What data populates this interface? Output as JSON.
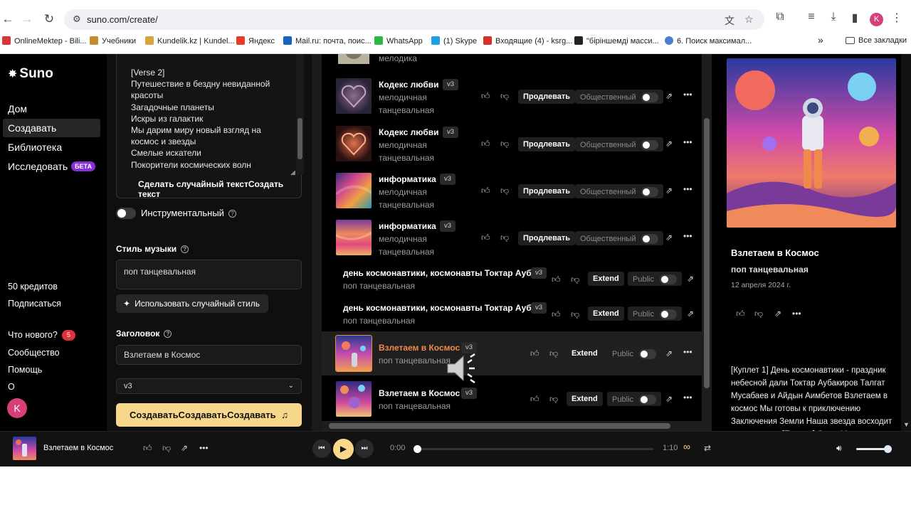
{
  "browser": {
    "url": "suno.com/create/",
    "profile_initial": "K",
    "bookmarks": [
      {
        "label": "OnlineMektep - Bili...",
        "color": "#d9343a"
      },
      {
        "label": "Учебники",
        "color": "#c58b2e"
      },
      {
        "label": "Kundelik.kz | Kundel...",
        "color": "#d8a33c"
      },
      {
        "label": "Яндекс",
        "color": "#e83b2a"
      },
      {
        "label": "Mail.ru: почта, поис...",
        "color": "#1565c0"
      },
      {
        "label": "WhatsApp",
        "color": "#2bb741"
      },
      {
        "label": "(1) Skype",
        "color": "#1ea0e6"
      },
      {
        "label": "Входящие (4) - ksrg...",
        "color": "#d93025"
      },
      {
        "label": "\"біріншемді масси...",
        "color": "#222222"
      },
      {
        "label": "6. Поиск максимал...",
        "color": "#4a7fd4"
      }
    ],
    "more_bookmarks": "»",
    "all_bookmarks": "Все закладки"
  },
  "sidebar": {
    "logo": "Suno",
    "nav": [
      {
        "label": "Дом"
      },
      {
        "label": "Создавать"
      },
      {
        "label": "Библиотека"
      },
      {
        "label": "Исследовать",
        "badge": "БЕТА"
      }
    ],
    "credits": "50 кредитов",
    "subscribe": "Подписаться",
    "whats_new": "Что нового?",
    "whats_new_count": "5",
    "community": "Сообщество",
    "help": "Помощь",
    "about": "О",
    "avatar": "K"
  },
  "create": {
    "lyrics": "[Verse 2]\nПутешествие в бездну невиданной красоты\nЗагадочные планеты\nИскры из галактик\nМы дарим миру новый взгляд на космос и звезды\nСмелые искатели\nПокорители космических волн",
    "random_lyrics_btn": "Сделать случайный текстСоздать текст",
    "instrumental_label": "Инструментальный",
    "style_label": "Стиль музыки",
    "style_value": "поп танцевальная",
    "random_style_btn": "Использовать случайный стиль",
    "title_label": "Заголовок",
    "title_value": "Взлетаем в Космос",
    "version_value": "v3",
    "create_btn": "СоздаватьСоздаватьСоздавать"
  },
  "songs": {
    "partial_style": "мелодика",
    "extend_ru": "Продлевать",
    "public_ru": "Общественный",
    "extend_en": "Extend",
    "public_en": "Public",
    "rows": [
      {
        "title": "Кодекс любви",
        "version": "v3",
        "style1": "мелодичная",
        "style2": "танцевальная"
      },
      {
        "title": "Кодекс любви",
        "version": "v3",
        "style1": "мелодичная",
        "style2": "танцевальная"
      },
      {
        "title": "информатика",
        "version": "v3",
        "style1": "мелодичная",
        "style2": "танцевальная"
      },
      {
        "title": "информатика",
        "version": "v3",
        "style1": "мелодичная",
        "style2": "танцевальная"
      },
      {
        "title": "день космонавтики, космонавты Токтар Ауб",
        "version": "v3",
        "style1": "поп танцевальная"
      },
      {
        "title": "день космонавтики, космонавты Токтар Ауб",
        "version": "v3",
        "style1": "поп танцевальная"
      },
      {
        "title": "Взлетаем в Космос",
        "version": "v3",
        "style1": "поп танцевальная"
      },
      {
        "title": "Взлетаем в Космос",
        "version": "v3",
        "style1": "поп танцевальная"
      }
    ]
  },
  "detail": {
    "title": "Взлетаем в Космос",
    "style": "поп танцевальная",
    "date": "12 апреля 2024 г.",
    "lyrics": "[Куплет 1] День космонавтики - праздник небесной дали Токтар Аубакиров Талгат Мусабаев и Айдын Аимбетов Взлетаем в космос Мы готовы к приключению Заключения Земли Наша звезда восходит на горизонте [Припев] О-о-о Мы взлетаем"
  },
  "player": {
    "title": "Взлетаем в Космос",
    "time_current": "0:00",
    "time_total": "1:10",
    "progress": 0.0,
    "volume": 0.9
  },
  "colors": {
    "accent": "#f8d68a",
    "playing_title": "#f08a4b",
    "beta": "#8a2fd6",
    "badge": "#e0323c"
  }
}
